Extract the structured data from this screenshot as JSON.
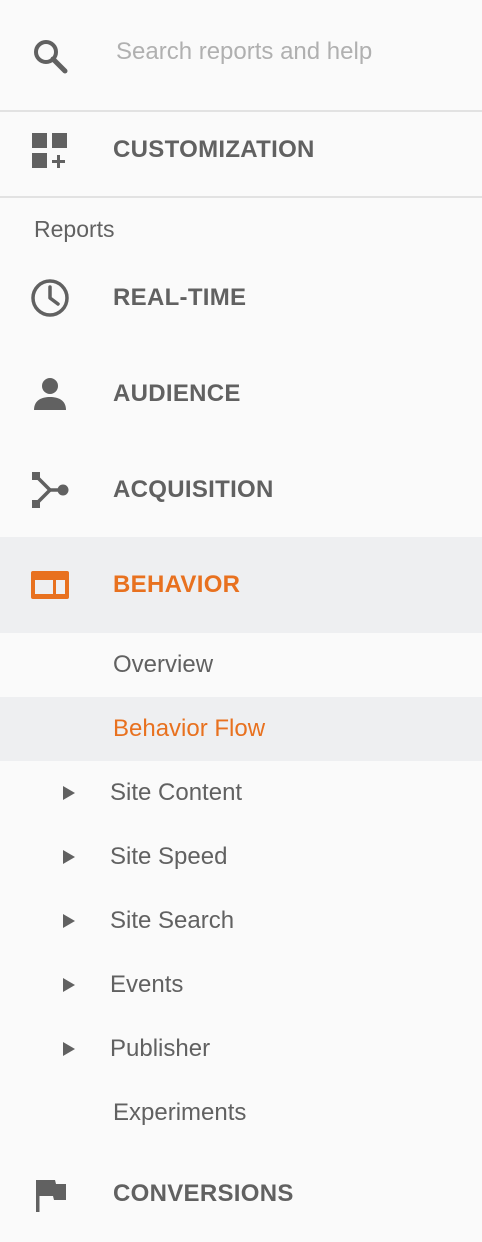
{
  "search": {
    "placeholder": "Search reports and help",
    "icon": "search-icon"
  },
  "customization": {
    "label": "CUSTOMIZATION",
    "icon": "dashboard-add-icon"
  },
  "reports": {
    "title": "Reports",
    "items": [
      {
        "label": "REAL-TIME",
        "icon": "clock-icon"
      },
      {
        "label": "AUDIENCE",
        "icon": "person-icon"
      },
      {
        "label": "ACQUISITION",
        "icon": "acquisition-icon"
      },
      {
        "label": "BEHAVIOR",
        "icon": "browser-window-icon",
        "active": true
      },
      {
        "label": "CONVERSIONS",
        "icon": "flag-icon"
      }
    ],
    "behavior_sub": [
      {
        "label": "Overview"
      },
      {
        "label": "Behavior Flow",
        "selected": true
      },
      {
        "label": "Site Content",
        "expandable": true
      },
      {
        "label": "Site Speed",
        "expandable": true
      },
      {
        "label": "Site Search",
        "expandable": true
      },
      {
        "label": "Events",
        "expandable": true
      },
      {
        "label": "Publisher",
        "expandable": true
      },
      {
        "label": "Experiments"
      }
    ]
  },
  "colors": {
    "accent": "#e8711f",
    "text": "#616161",
    "icon": "#616161",
    "active_bg": "#eeeff1",
    "background": "#fafafa",
    "placeholder": "#b0b0b0"
  }
}
